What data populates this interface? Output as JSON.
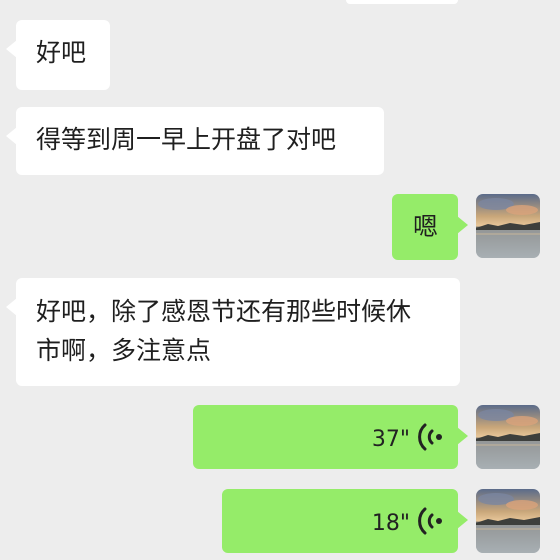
{
  "messages": [
    {
      "side": "in",
      "type": "text",
      "text": "好吧"
    },
    {
      "side": "in",
      "type": "text",
      "text": "得等到周一早上开盘了对吧"
    },
    {
      "side": "out",
      "type": "text",
      "text": "嗯"
    },
    {
      "side": "in",
      "type": "text",
      "lines": [
        "好吧，除了感恩节还有那些时候休",
        "市啊，多注意点"
      ]
    },
    {
      "side": "out",
      "type": "voice",
      "duration": "37\""
    },
    {
      "side": "out",
      "type": "voice",
      "duration": "18\""
    }
  ],
  "icons": {
    "avatar": "sunset-lake-avatar",
    "voice": "voice-wave-icon"
  },
  "colors": {
    "background": "#ededed",
    "incoming_bubble": "#ffffff",
    "outgoing_bubble": "#95ec69"
  }
}
